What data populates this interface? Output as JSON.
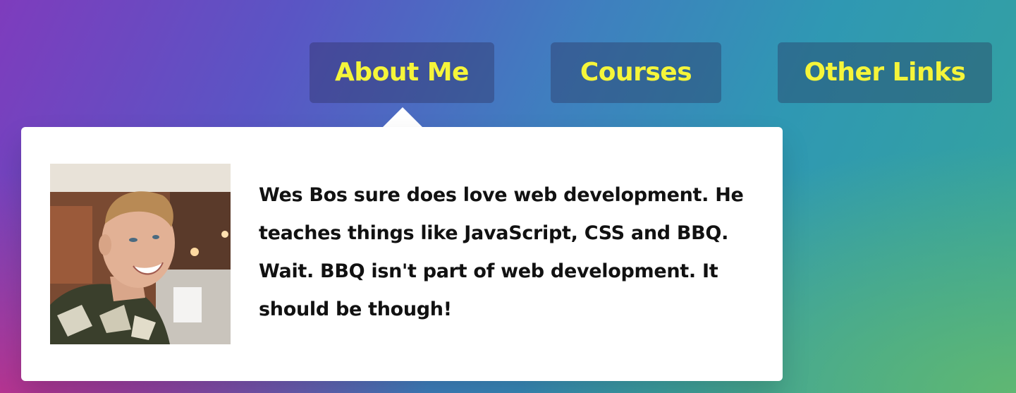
{
  "nav": {
    "items": [
      {
        "label": "About Me"
      },
      {
        "label": "Courses"
      },
      {
        "label": "Other Links"
      }
    ]
  },
  "dropdown": {
    "bio_text": "Wes Bos sure does love web development. He teaches things like JavaScript, CSS and BBQ. Wait. BBQ isn't part of web development. It should be though!"
  },
  "colors": {
    "nav_text": "#f5f53a",
    "dropdown_bg": "#ffffff",
    "bio_text": "#111111"
  }
}
